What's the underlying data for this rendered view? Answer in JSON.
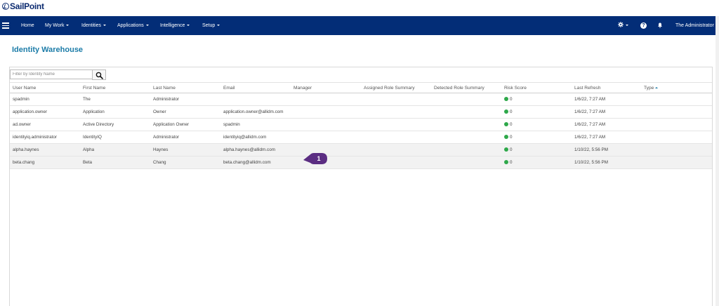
{
  "brand": {
    "name": "SailPoint"
  },
  "nav": {
    "items": [
      {
        "label": "Home",
        "dropdown": false
      },
      {
        "label": "My Work",
        "dropdown": true
      },
      {
        "label": "Identities",
        "dropdown": true
      },
      {
        "label": "Applications",
        "dropdown": true
      },
      {
        "label": "Intelligence",
        "dropdown": true
      },
      {
        "label": "Setup",
        "dropdown": true
      }
    ],
    "help_label": "?",
    "user_label": "The Administrator",
    "icons": [
      "menu-icon",
      "gear-icon",
      "help-icon",
      "bell-icon"
    ]
  },
  "page": {
    "title": "Identity Warehouse"
  },
  "search": {
    "placeholder": "Filter by Identity Name",
    "value": ""
  },
  "table": {
    "columns": [
      "User Name",
      "First Name",
      "Last Name",
      "Email",
      "Manager",
      "Assigned Role Summary",
      "Detected Role Summary",
      "Risk Score",
      "Last Refresh",
      "Type"
    ],
    "sorted_column": "Type",
    "rows": [
      {
        "user_name": "spadmin",
        "first_name": "The",
        "last_name": "Administrator",
        "email": "",
        "manager": "",
        "assigned": "",
        "detected": "",
        "risk": "0",
        "last_refresh": "1/6/22, 7:27 AM",
        "type": ""
      },
      {
        "user_name": "application.owner",
        "first_name": "Application",
        "last_name": "Owner",
        "email": "application.owner@allidm.com",
        "manager": "",
        "assigned": "",
        "detected": "",
        "risk": "0",
        "last_refresh": "1/6/22, 7:27 AM",
        "type": ""
      },
      {
        "user_name": "ad.owner",
        "first_name": "Active Directory",
        "last_name": "Application Owner",
        "email": "spadmin",
        "manager": "",
        "assigned": "",
        "detected": "",
        "risk": "0",
        "last_refresh": "1/6/22, 7:27 AM",
        "type": ""
      },
      {
        "user_name": "identityiq.administrator",
        "first_name": "IdentityIQ",
        "last_name": "Administrator",
        "email": "identityiq@allidm.com",
        "manager": "",
        "assigned": "",
        "detected": "",
        "risk": "0",
        "last_refresh": "1/6/22, 7:27 AM",
        "type": ""
      },
      {
        "user_name": "alpha.haynes",
        "first_name": "Alpha",
        "last_name": "Haynes",
        "email": "alpha.haynes@allidm.com",
        "manager": "",
        "assigned": "",
        "detected": "",
        "risk": "0",
        "last_refresh": "1/10/22, 5:56 PM",
        "type": ""
      },
      {
        "user_name": "beta.chang",
        "first_name": "Beta",
        "last_name": "Chang",
        "email": "beta.chang@allidm.com",
        "manager": "",
        "assigned": "",
        "detected": "",
        "risk": "0",
        "last_refresh": "1/10/22, 5:56 PM",
        "type": ""
      }
    ],
    "highlighted_rows": [
      4,
      5
    ]
  },
  "callout": {
    "label": "1",
    "color": "#5b2d82"
  },
  "colors": {
    "navbar": "#032d77",
    "accent": "#1c7ca8",
    "risk_ok": "#2ea84a"
  }
}
